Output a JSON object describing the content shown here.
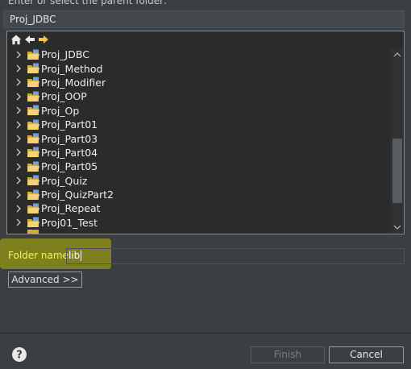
{
  "dialog": {
    "prompt": "Enter or select the parent folder:",
    "parent_folder": "Proj_JDBC"
  },
  "tree": {
    "toolbar": {
      "home_icon": "home-icon",
      "back_icon": "back-arrow-icon",
      "forward_icon": "forward-arrow-icon"
    },
    "items": [
      {
        "label": "Proj_JDBC"
      },
      {
        "label": "Proj_Method"
      },
      {
        "label": "Proj_Modifier"
      },
      {
        "label": "Proj_OOP"
      },
      {
        "label": "Proj_Op"
      },
      {
        "label": "Proj_Part01"
      },
      {
        "label": "Proj_Part03"
      },
      {
        "label": "Proj_Part04"
      },
      {
        "label": "Proj_Part05"
      },
      {
        "label": "Proj_Quiz"
      },
      {
        "label": "Proj_QuizPart2"
      },
      {
        "label": "Proj_Repeat"
      },
      {
        "label": "Proj01_Test"
      }
    ]
  },
  "folder_name": {
    "label": "Folder name:",
    "value": "lib"
  },
  "advanced_button": "Advanced >>",
  "footer": {
    "finish_label": "Finish",
    "cancel_label": "Cancel",
    "help_icon": "help-icon"
  },
  "colors": {
    "background": "#3c3f41",
    "tree_background": "#2b2b2b",
    "highlight": "#8a8c17",
    "folder_label": "#f2f25a"
  }
}
